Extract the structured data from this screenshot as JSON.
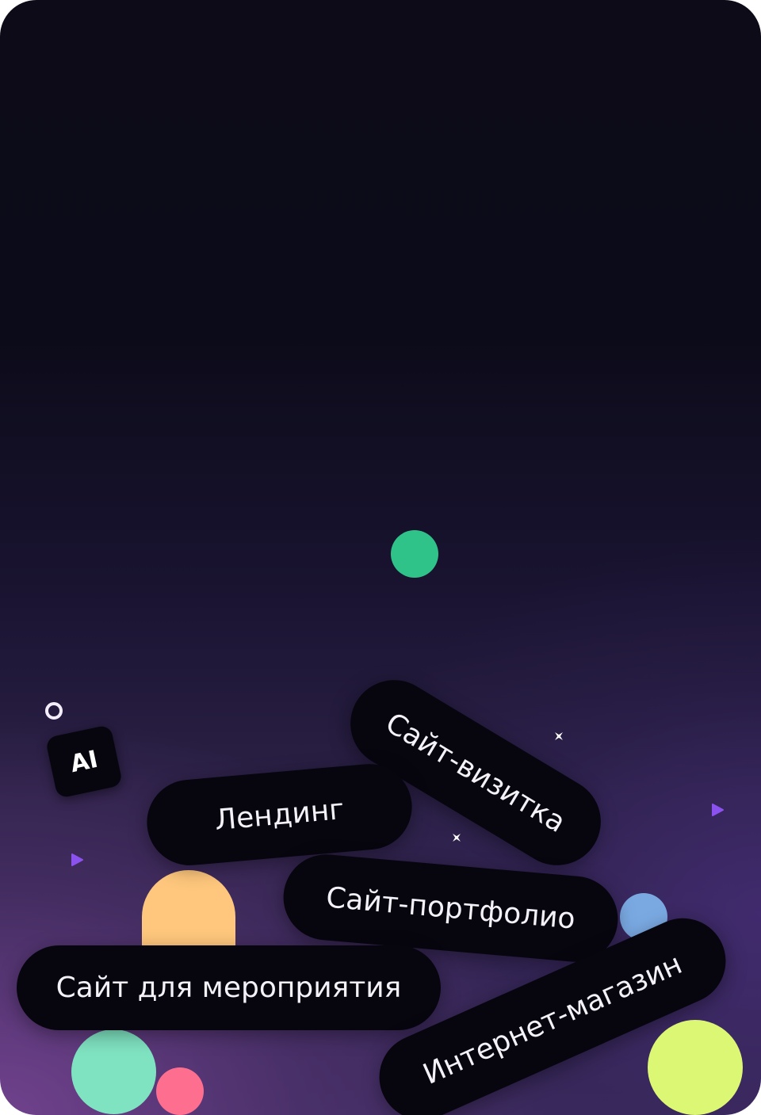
{
  "tags": {
    "business_card": "Сайт-визитка",
    "landing": "Лендинг",
    "portfolio": "Сайт-портфолио",
    "event": "Сайт для мероприятия",
    "shop": "Интернет-магазин"
  },
  "ai_badge": "AI",
  "colors": {
    "pill_bg": "#07060f",
    "green": "#2fc38a",
    "orange": "#fec77d",
    "blue": "#7aa9e2",
    "mint": "#7fe2c0",
    "pink": "#fe6f8f",
    "lime": "#dcf774",
    "accent_purple": "#8c52f0"
  },
  "icons": [
    "ring-icon",
    "sparkle-icon",
    "triangle-icon"
  ]
}
